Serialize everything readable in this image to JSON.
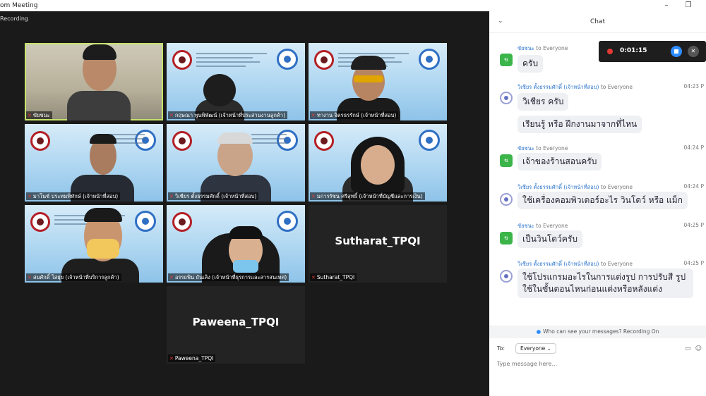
{
  "window": {
    "title": "om Meeting",
    "min_glyph": "–",
    "restore_glyph": "❐"
  },
  "video": {
    "recording_label": "Recording",
    "tiles": [
      {
        "name": "ขัยชนะ"
      },
      {
        "name": "กฤษณา พูนพิพัฒน์ (เจ้าหน้าที่ประสานงานลูกค้า)"
      },
      {
        "name": "ทางาน จิตรธรรักษ์ (เจ้าหน้าที่สอบ)"
      },
      {
        "name": "มาโนช์ ประทมพิทักษ์ (เจ้าหน้าที่สอบ)"
      },
      {
        "name": "วิเชียร ตั้งธรรมศักดิ์ (เจ้าหน้าที่สอบ)"
      },
      {
        "name": "มการรัชน ศรีสุทธิ์ (เจ้าหน้าที่บัญชีและการเงิน)"
      },
      {
        "name": "สมศักดิ์ ไสยุ่ย (เจ้าหน้าที่บริการลูกค้า)"
      },
      {
        "name": "อรรถพิน ถันเลิง (เจ้าหน้าที่ธุรการและสารสนเทศ)"
      },
      {
        "name": "Sutharat_TPQI",
        "big": "Sutharat_TPQI"
      },
      {
        "name": "Paweena_TPQI",
        "big": "Paweena_TPQI"
      }
    ]
  },
  "recording_bar": {
    "time": "0:01:15"
  },
  "chat": {
    "title": "Chat",
    "collapse_glyph": "⌄",
    "to_everyone": "to Everyone",
    "messages": [
      {
        "sender": "ขัยชนะ",
        "time": "",
        "avatar": "ข",
        "lines": [
          "ครับ"
        ]
      },
      {
        "sender": "วิเชียร ตั้งธรรมศักดิ์ (เจ้าหน้าที่สอบ)",
        "time": "04:23 P",
        "lines": [
          "วิเชียร ครับ",
          "เรียนรู้ หรือ ฝึกงานมาจากที่ไหน"
        ]
      },
      {
        "sender": "ขัยชนะ",
        "time": "04:24 P",
        "avatar": "ข",
        "lines": [
          "เจ้าของร้านสอนครับ"
        ]
      },
      {
        "sender": "วิเชียร ตั้งธรรมศักดิ์ (เจ้าหน้าที่สอบ)",
        "time": "04:24 P",
        "lines": [
          "ใช้เครื่องคอมพิวเตอร์อะไร วินโดว์ หรือ แม็ก"
        ]
      },
      {
        "sender": "ขัยชนะ",
        "time": "04:25 P",
        "avatar": "ข",
        "lines": [
          "เป็นวินโดว์ครับ"
        ]
      },
      {
        "sender": "วิเชียร ตั้งธรรมศักดิ์ (เจ้าหน้าที่สอบ)",
        "time": "04:25 P",
        "lines": [
          "ใช้โปรแกรมอะไรในการแต่งรูป การปรับสี รูป ใช้ในขั้นตอนไหนก่อนแต่งหรือหลังแต่ง"
        ]
      }
    ],
    "privacy_note": "Who can see your messages? Recording On",
    "to_label": "To:",
    "to_value": "Everyone",
    "input_placeholder": "Type message here..."
  }
}
